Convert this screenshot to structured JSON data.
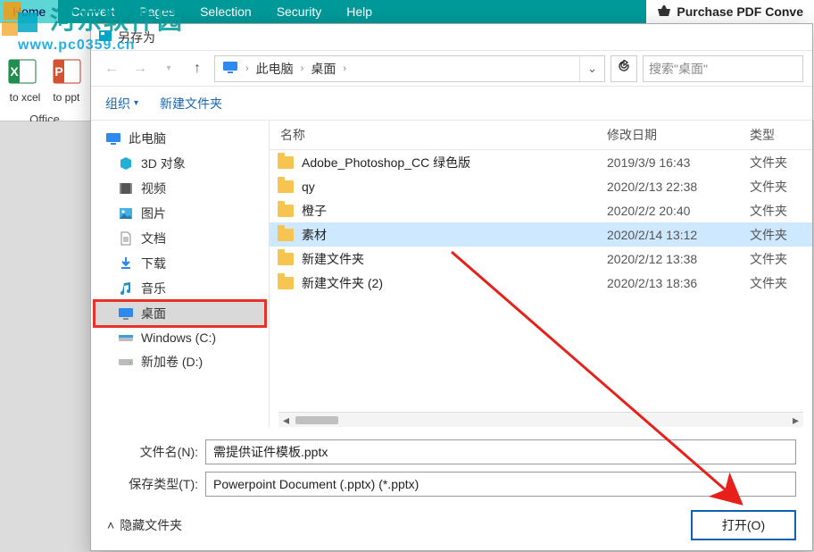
{
  "menubar": {
    "items": [
      "Home",
      "Convert",
      "Pages",
      "Selection",
      "Security",
      "Help"
    ],
    "active": 0,
    "purchase": "Purchase PDF Conve"
  },
  "watermark": {
    "title": "河东软件园",
    "url": "www.pc0359.cn"
  },
  "ribbon": {
    "to_excel": "to xcel",
    "to_ppt": "to ppt",
    "group": "Office"
  },
  "dialog": {
    "title": "另存为",
    "nav": {
      "back_enabled": false,
      "forward_enabled": false
    },
    "breadcrumb": [
      "此电脑",
      "桌面"
    ],
    "search_placeholder": "搜索\"桌面\"",
    "toolbar": {
      "organize": "组织",
      "newfolder": "新建文件夹"
    },
    "tree": [
      {
        "icon": "pc",
        "label": "此电脑",
        "root": true
      },
      {
        "icon": "3d",
        "label": "3D 对象"
      },
      {
        "icon": "video",
        "label": "视频"
      },
      {
        "icon": "images",
        "label": "图片"
      },
      {
        "icon": "docs",
        "label": "文档"
      },
      {
        "icon": "download",
        "label": "下载"
      },
      {
        "icon": "music",
        "label": "音乐"
      },
      {
        "icon": "desktop",
        "label": "桌面",
        "selected": true,
        "highlight": true
      },
      {
        "icon": "drive",
        "label": "Windows (C:)"
      },
      {
        "icon": "drive",
        "label": "新加卷 (D:)"
      }
    ],
    "columns": {
      "name": "名称",
      "date": "修改日期",
      "type": "类型"
    },
    "rows": [
      {
        "name": "Adobe_Photoshop_CC 绿色版",
        "date": "2019/3/9 16:43",
        "type": "文件夹"
      },
      {
        "name": "qy",
        "date": "2020/2/13 22:38",
        "type": "文件夹"
      },
      {
        "name": "橙子",
        "date": "2020/2/2 20:40",
        "type": "文件夹"
      },
      {
        "name": "素材",
        "date": "2020/2/14 13:12",
        "type": "文件夹",
        "selected": true
      },
      {
        "name": "新建文件夹",
        "date": "2020/2/12 13:38",
        "type": "文件夹"
      },
      {
        "name": "新建文件夹 (2)",
        "date": "2020/2/13 18:36",
        "type": "文件夹"
      }
    ],
    "filename_label": "文件名(N):",
    "filename_value": "需提供证件模板.pptx",
    "filetype_label": "保存类型(T):",
    "filetype_value": "Powerpoint Document (.pptx) (*.pptx)",
    "hide_folders": "隐藏文件夹",
    "open_button": "打开(O)"
  }
}
